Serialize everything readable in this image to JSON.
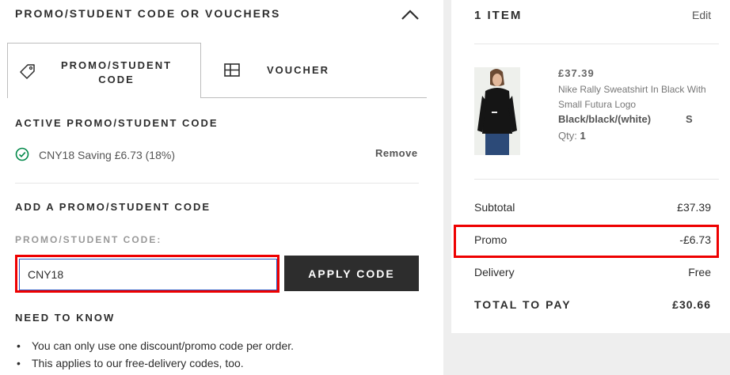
{
  "promo_section": {
    "heading": "PROMO/STUDENT CODE OR VOUCHERS",
    "tabs": [
      {
        "label": "PROMO/STUDENT CODE",
        "icon": "tag-icon"
      },
      {
        "label": "VOUCHER",
        "icon": "voucher-icon"
      }
    ],
    "active": {
      "heading": "ACTIVE PROMO/STUDENT CODE",
      "code_text": "CNY18 Saving £6.73 (18%)",
      "remove_label": "Remove"
    },
    "add": {
      "heading": "ADD A PROMO/STUDENT CODE",
      "field_label": "PROMO/STUDENT CODE:",
      "input_value": "CNY18",
      "apply_label": "APPLY CODE"
    },
    "need_to_know": {
      "heading": "NEED TO KNOW",
      "items": [
        "You can only use one discount/promo code per order.",
        "This applies to our free-delivery codes, too."
      ]
    }
  },
  "bag": {
    "heading": "1 ITEM",
    "edit_label": "Edit",
    "item": {
      "price": "£37.39",
      "name": "Nike Rally Sweatshirt In Black With Small Futura Logo",
      "color": "Black/black/(white)",
      "size": "S",
      "qty_label": "Qty:",
      "qty": "1"
    },
    "summary": {
      "subtotal_label": "Subtotal",
      "subtotal": "£37.39",
      "promo_label": "Promo",
      "promo": "-£6.73",
      "delivery_label": "Delivery",
      "delivery": "Free",
      "total_label": "TOTAL TO PAY",
      "total": "£30.66"
    }
  },
  "colors": {
    "accent_dark": "#2d2d2d",
    "success_green": "#018849",
    "highlight_red": "#ee0000",
    "input_focus_blue": "#2b59c3"
  }
}
